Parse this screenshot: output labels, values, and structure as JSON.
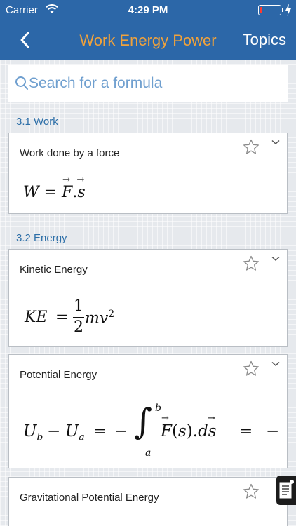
{
  "status_bar": {
    "carrier": "Carrier",
    "time": "4:29 PM",
    "battery_level": 0.12,
    "battery_color": "#ff3b30"
  },
  "nav": {
    "back_icon": "chevron-left-icon",
    "title": "Work Energy Power",
    "topics_label": "Topics"
  },
  "search": {
    "placeholder": "Search for a formula",
    "value": "",
    "icon": "search-icon"
  },
  "colors": {
    "header": "#2c67a8",
    "title_accent": "#f0a23c",
    "section_title": "#2d6fa8"
  },
  "sections": [
    {
      "title": "3.1 Work",
      "cards": [
        {
          "title": "Work done by a force",
          "formula": "W = F⃗.s⃗"
        }
      ]
    },
    {
      "title": "3.2 Energy",
      "cards": [
        {
          "title": "Kinetic Energy",
          "formula": "KE = ½mv²"
        },
        {
          "title": "Potential Energy",
          "formula": "U_b − U_a = −∫_a^b F⃗(s).ds⃗ = −"
        },
        {
          "title": "Gravitational Potential Energy",
          "formula": ""
        }
      ]
    }
  ],
  "notes_icon": "notes-icon"
}
